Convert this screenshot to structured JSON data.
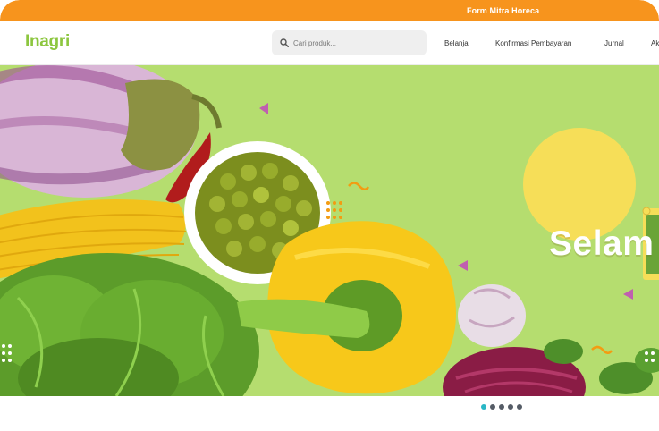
{
  "topbar": {
    "link_label": "Form Mitra Horeca"
  },
  "header": {
    "logo": "Inagri",
    "search": {
      "placeholder": "Cari produk...",
      "value": ""
    },
    "nav": [
      {
        "label": "Belanja"
      },
      {
        "label": "Konfirmasi Pembayaran"
      },
      {
        "label": "Jurnal"
      },
      {
        "label": "Ak"
      }
    ]
  },
  "banner": {
    "headline": "Selam",
    "slides_total": 5,
    "active_slide": 1
  },
  "colors": {
    "topbar": "#f7941d",
    "brand": "#8cc63f",
    "hero_background": "#b5dd6f",
    "dot_active": "#2ab7c6",
    "dot_inactive": "#555c66"
  }
}
